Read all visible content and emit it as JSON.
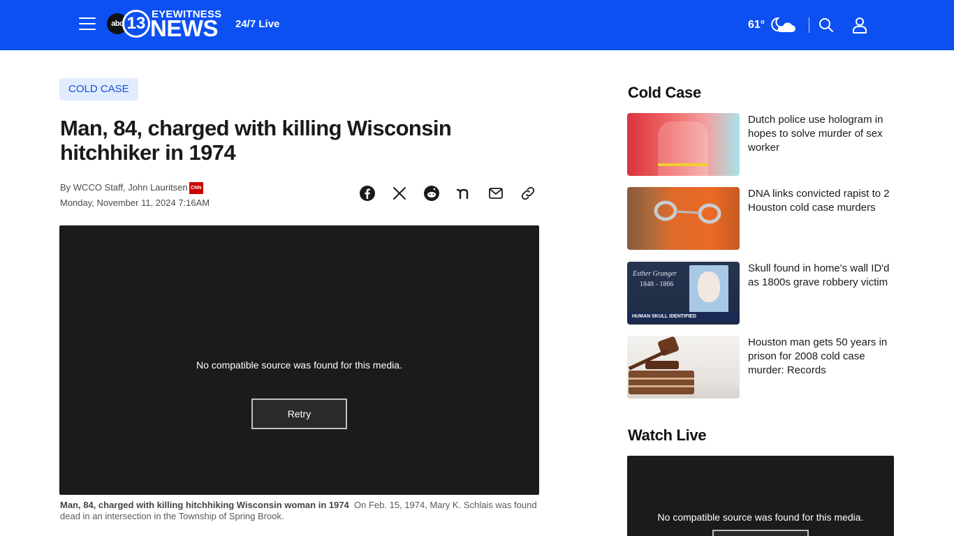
{
  "header": {
    "menu_icon": "hamburger-menu-icon",
    "logo": {
      "abc": "abc",
      "number": "13",
      "eyewitness": "EYEWITNESS",
      "news": "NEWS"
    },
    "live_label": "24/7 Live",
    "temperature": "61°",
    "weather_icon": "partly-cloudy-night-icon",
    "search_icon": "search-icon",
    "account_icon": "user-icon",
    "bg_color": "#0d50f2"
  },
  "article": {
    "tag": "COLD CASE",
    "headline": "Man, 84, charged with killing Wisconsin hitchhiker in 1974",
    "byline": "By WCCO Staff, John Lauritsen",
    "byline_badge": "CNN",
    "date": "Monday, November 11, 2024 7:16AM",
    "share_icons": [
      "facebook-icon",
      "x-icon",
      "reddit-icon",
      "nextdoor-icon",
      "email-icon",
      "link-icon"
    ],
    "video": {
      "message": "No compatible source was found for this media.",
      "retry_label": "Retry"
    },
    "caption_title": "Man, 84, charged with killing hitchhiking Wisconsin woman in 1974",
    "caption_text": "On Feb. 15, 1974, Mary K. Schlais was found dead in an intersection in the Township of Spring Brook."
  },
  "sidebar": {
    "section_title": "Cold Case",
    "items": [
      {
        "title": "Dutch police use hologram in hopes to solve murder of sex worker"
      },
      {
        "title": "DNA links convicted rapist to 2 Houston cold case murders"
      },
      {
        "title": "Skull found in home's wall ID'd as 1800s grave robbery victim",
        "thumb_text_1": "Esther Granger",
        "thumb_text_2": "1848 - 1866",
        "thumb_banner": "HUMAN SKULL IDENTIFIED"
      },
      {
        "title": "Houston man gets 50 years in prison for 2008 cold case murder: Records"
      }
    ],
    "watch_title": "Watch Live",
    "watch_message": "No compatible source was found for this media."
  }
}
